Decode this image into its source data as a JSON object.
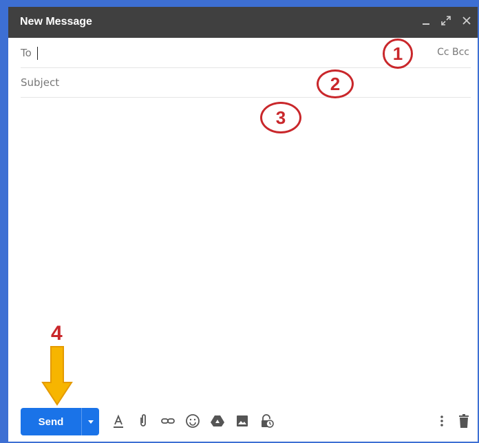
{
  "window": {
    "title": "New Message"
  },
  "fields": {
    "to_label": "To",
    "subject_label": "Subject",
    "cc_bcc": "Cc Bcc"
  },
  "annotations": {
    "one": "1",
    "two": "2",
    "three": "3",
    "four": "4"
  },
  "toolbar": {
    "send_label": "Send"
  },
  "icons": [
    "minimize-icon",
    "expand-icon",
    "close-icon",
    "send-options-icon",
    "format-text-icon",
    "attach-icon",
    "link-icon",
    "emoji-icon",
    "drive-icon",
    "photo-icon",
    "confidential-icon",
    "more-options-icon",
    "trash-icon"
  ],
  "colors": {
    "titlebar": "#404040",
    "send": "#1a73e8",
    "annotation": "#c9272b",
    "arrow": "#f7b500",
    "frame": "#3d6fd3"
  }
}
